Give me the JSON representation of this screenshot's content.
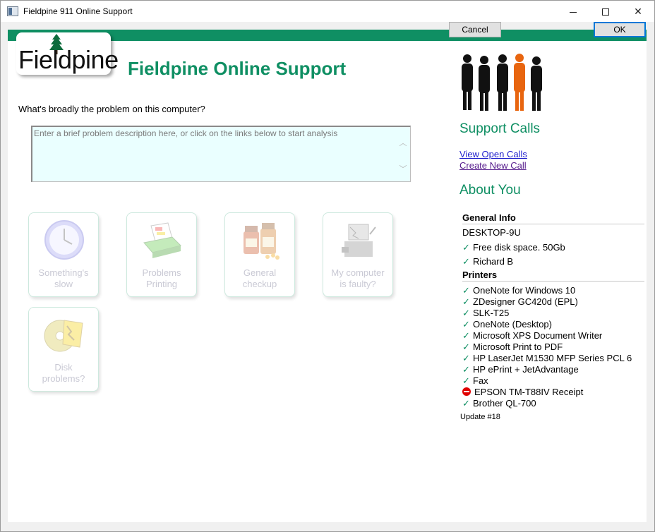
{
  "window": {
    "title": "Fieldpine 911 Online Support"
  },
  "buttons": {
    "cancel": "Cancel",
    "ok": "OK"
  },
  "logo": {
    "text": "Fieldpine"
  },
  "main_title": "Fieldpine Online Support",
  "question": "What's broadly the problem on this computer?",
  "problem_input": {
    "placeholder": "Enter a brief problem description here, or click on the links below to start analysis",
    "value": ""
  },
  "tiles": [
    {
      "line1": "Something's",
      "line2": "slow",
      "icon": "clock-icon"
    },
    {
      "line1": "Problems",
      "line2": "Printing",
      "icon": "printer-icon"
    },
    {
      "line1": "General",
      "line2": "checkup",
      "icon": "vitamins-icon"
    },
    {
      "line1": "My computer",
      "line2": "is faulty?",
      "icon": "broken-computer-icon"
    },
    {
      "line1": "Disk",
      "line2": "problems?",
      "icon": "disk-icon"
    }
  ],
  "support_calls": {
    "heading": "Support Calls",
    "view_open": "View Open Calls",
    "create_new": "Create New Call"
  },
  "about": {
    "heading": "About You",
    "general_info": "General Info",
    "computer_name": "DESKTOP-9U",
    "disk_space": "Free disk space. 50Gb",
    "user": "Richard B",
    "printers_heading": "Printers",
    "printers": [
      {
        "name": "OneNote for Windows 10",
        "status": "ok"
      },
      {
        "name": "ZDesigner GC420d (EPL)",
        "status": "ok"
      },
      {
        "name": "SLK-T25",
        "status": "ok"
      },
      {
        "name": "OneNote (Desktop)",
        "status": "ok"
      },
      {
        "name": "Microsoft XPS Document Writer",
        "status": "ok"
      },
      {
        "name": "Microsoft Print to PDF",
        "status": "ok"
      },
      {
        "name": "HP LaserJet M1530 MFP Series PCL 6",
        "status": "ok"
      },
      {
        "name": "HP ePrint + JetAdvantage",
        "status": "ok"
      },
      {
        "name": "Fax",
        "status": "ok"
      },
      {
        "name": "EPSON TM-T88IV Receipt",
        "status": "error"
      },
      {
        "name": "Brother QL-700",
        "status": "ok"
      }
    ],
    "update": "Update #18"
  },
  "colors": {
    "brand_green": "#0f8f63",
    "input_bg": "#eaffff",
    "link": "#1c1ccc",
    "error": "#e00000"
  }
}
